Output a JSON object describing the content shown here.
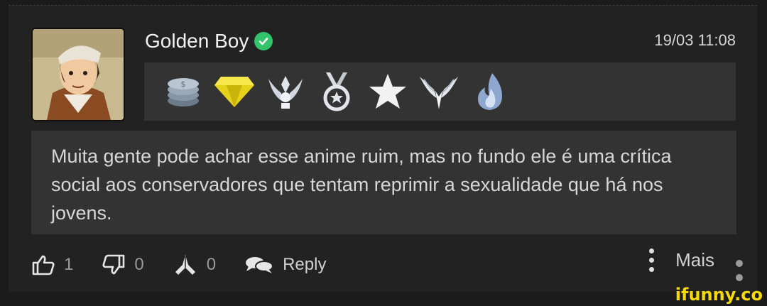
{
  "post": {
    "username": "Golden Boy",
    "timestamp": "19/03 11:08",
    "comment": "Muita gente pode achar esse anime ruim, mas no fundo ele é uma crítica social aos conservadores que tentam reprimir a sexualidade que há nos jovens.",
    "badges": [
      "coins-icon",
      "diamond-icon",
      "winged-badge-icon",
      "medal-icon",
      "star-icon",
      "wings-icon",
      "flame-icon"
    ]
  },
  "actions": {
    "likes": "1",
    "dislikes": "0",
    "prays": "0",
    "reply_label": "Reply",
    "more_label": "Mais"
  },
  "watermark": "ifunny.co",
  "colors": {
    "background": "#1b1b1b",
    "card": "#222222",
    "panel": "#333333",
    "verified": "#33c36a",
    "watermark": "#f5d90a"
  }
}
